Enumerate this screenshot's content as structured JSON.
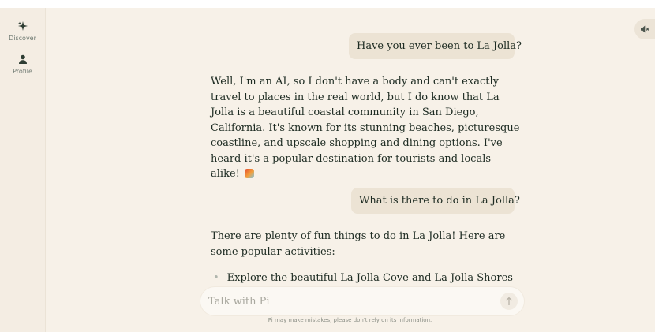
{
  "sidebar": {
    "items": [
      {
        "label": "Discover",
        "icon": "sparkle-icon"
      },
      {
        "label": "Profile",
        "icon": "person-icon"
      }
    ]
  },
  "header": {
    "speaker_icon": "speaker-mute-icon"
  },
  "chat": {
    "messages": [
      {
        "role": "user",
        "text": "Have you ever been to La Jolla?"
      },
      {
        "role": "ai",
        "text": "Well, I'm an AI, so I don't have a body and can't exactly travel to places in the real world, but I do know that La Jolla is a beautiful coastal community in San Diego, California. It's known for its stunning beaches, picturesque coastline, and upscale shopping and dining options. I've heard it's a popular destination for tourists and locals alike!"
      },
      {
        "role": "user",
        "text": "What is there to do in La Jolla?"
      },
      {
        "role": "ai",
        "text": "There are plenty of fun things to do in La Jolla! Here are some popular activities:"
      }
    ],
    "list_items": [
      "Explore the beautiful La Jolla Cove and La Jolla Shores"
    ]
  },
  "composer": {
    "placeholder": "Talk with Pi",
    "send_icon": "arrow-up-icon"
  },
  "footer": {
    "disclaimer": "Pi may make mistakes, please don't rely on its information."
  },
  "colors": {
    "background": "#f7f1e8",
    "user_bubble": "#ece3d4",
    "text": "#1d2b22"
  }
}
